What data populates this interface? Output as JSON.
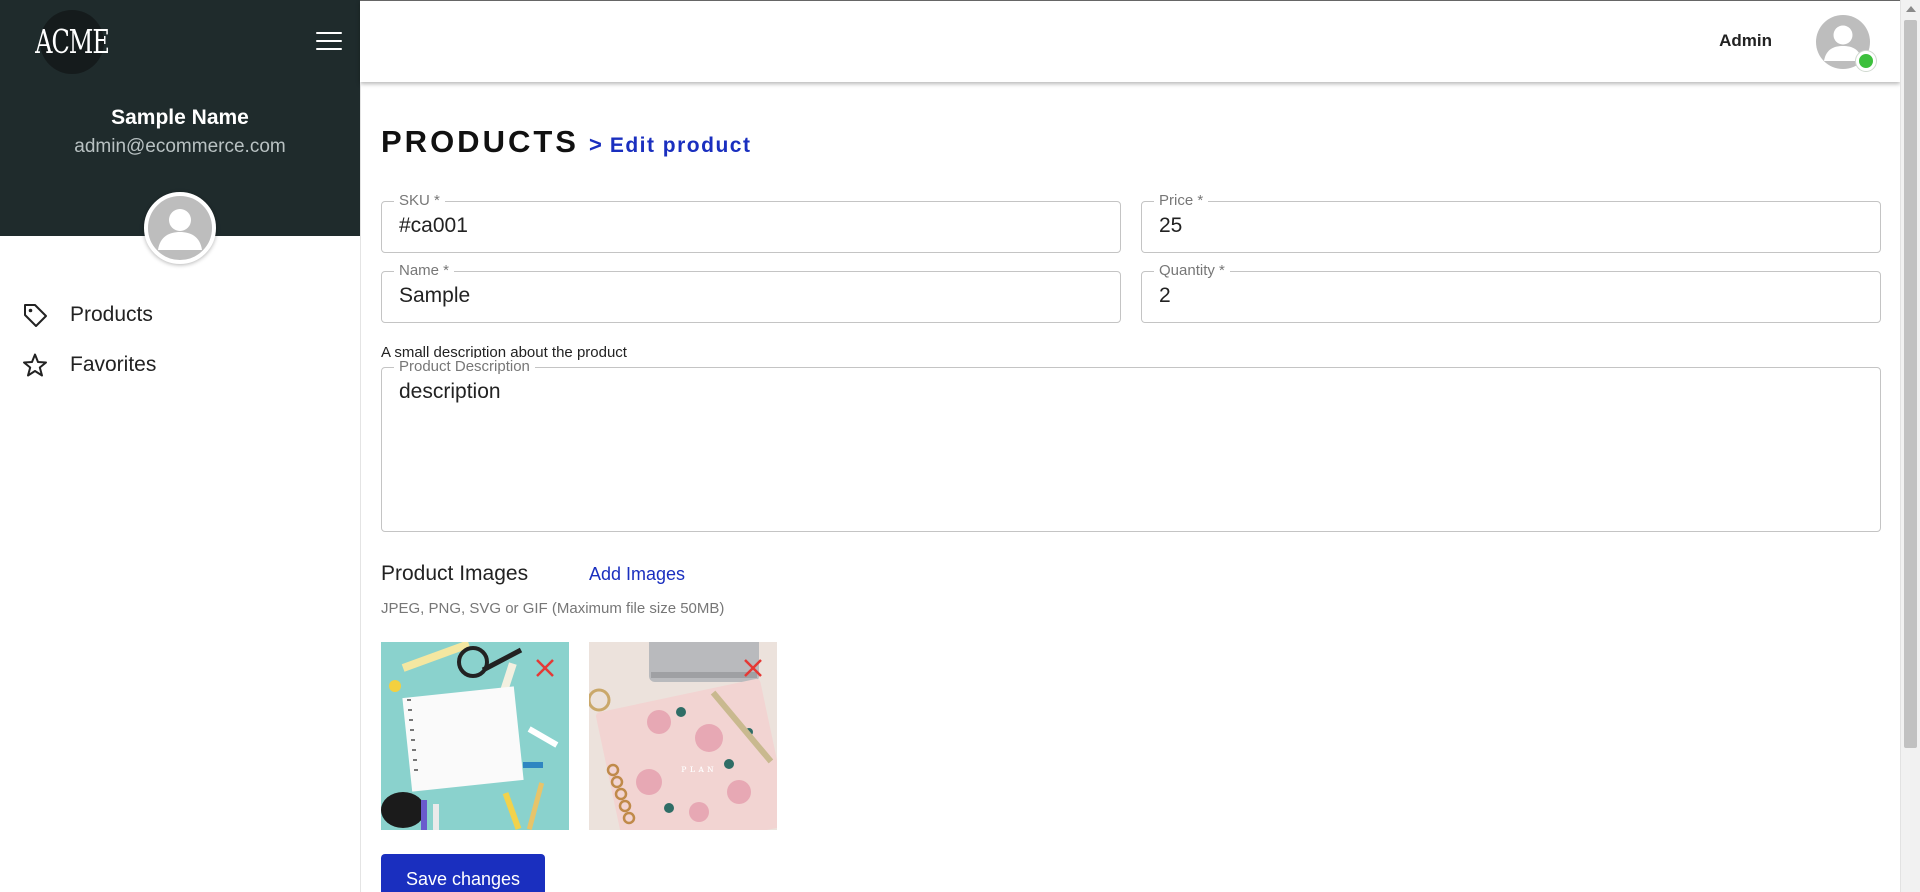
{
  "sidebar": {
    "logo_text": "ACME",
    "user_name": "Sample Name",
    "user_email": "admin@ecommerce.com",
    "items": [
      {
        "label": "Products",
        "icon": "tag-icon"
      },
      {
        "label": "Favorites",
        "icon": "star-icon"
      }
    ]
  },
  "topbar": {
    "admin_label": "Admin",
    "status_color": "#3cc03c"
  },
  "page": {
    "title": "PRODUCTS",
    "breadcrumb_separator": ">",
    "subtitle": "Edit product"
  },
  "form": {
    "sku": {
      "label": "SKU *",
      "value": "#ca001"
    },
    "price": {
      "label": "Price *",
      "value": "25"
    },
    "name": {
      "label": "Name *",
      "value": "Sample"
    },
    "quantity": {
      "label": "Quantity *",
      "value": "2"
    },
    "description_hint": "A small description about the product",
    "description": {
      "label": "Product Description",
      "value": "description"
    }
  },
  "images": {
    "title": "Product Images",
    "add_label": "Add Images",
    "note": "JPEG, PNG, SVG or GIF (Maximum file size 50MB)",
    "remove_icon": "close-icon",
    "remove_color": "#e53935"
  },
  "actions": {
    "save_label": "Save changes"
  },
  "colors": {
    "sidebar_bg": "#1f2b2c",
    "accent": "#1a2fbf"
  }
}
